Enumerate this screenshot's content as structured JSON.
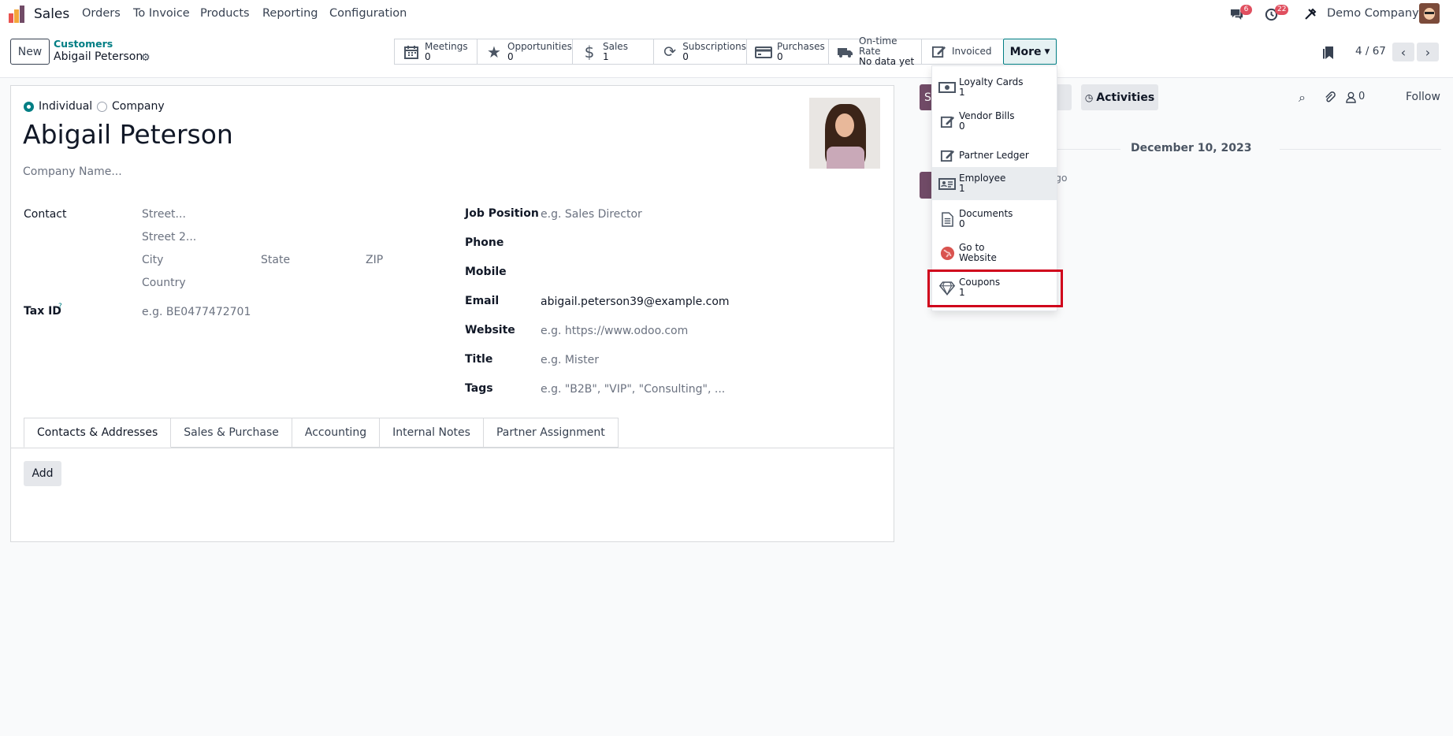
{
  "topnav": {
    "app_name": "Sales",
    "menu": [
      "Orders",
      "To Invoice",
      "Products",
      "Reporting",
      "Configuration"
    ],
    "messages_badge": "6",
    "activities_badge": "22",
    "company": "Demo Company"
  },
  "controlbar": {
    "new_label": "New",
    "breadcrumb_parent": "Customers",
    "breadcrumb_current": "Abigail Peterson",
    "smart_buttons": [
      {
        "label": "Meetings",
        "value": "0",
        "icon": "calendar-icon"
      },
      {
        "label": "Opportunities",
        "value": "0",
        "icon": "star-icon"
      },
      {
        "label": "Sales",
        "value": "1",
        "icon": "dollar-icon"
      },
      {
        "label": "Subscriptions",
        "value": "0",
        "icon": "refresh-icon"
      },
      {
        "label": "Purchases",
        "value": "0",
        "icon": "credit-card-icon"
      },
      {
        "label": "On-time Rate",
        "value": "No data yet",
        "icon": "truck-icon"
      },
      {
        "label": "Invoiced",
        "value": "",
        "icon": "edit-icon"
      }
    ],
    "more_label": "More",
    "pager": "4 / 67"
  },
  "form": {
    "type_individual": "Individual",
    "type_company": "Company",
    "name": "Abigail Peterson",
    "company_placeholder": "Company Name...",
    "contact_label": "Contact",
    "street_placeholder": "Street...",
    "street2_placeholder": "Street 2...",
    "city_placeholder": "City",
    "state_placeholder": "State",
    "zip_placeholder": "ZIP",
    "country_placeholder": "Country",
    "taxid_label": "Tax ID",
    "taxid_help": "?",
    "taxid_placeholder": "e.g. BE0477472701",
    "job_position_label": "Job Position",
    "job_position_placeholder": "e.g. Sales Director",
    "phone_label": "Phone",
    "mobile_label": "Mobile",
    "email_label": "Email",
    "email_value": "abigail.peterson39@example.com",
    "website_label": "Website",
    "website_placeholder": "e.g. https://www.odoo.com",
    "title_label": "Title",
    "title_placeholder": "e.g. Mister",
    "tags_label": "Tags",
    "tags_placeholder": "e.g. \"B2B\", \"VIP\", \"Consulting\", ...",
    "tabs": [
      "Contacts & Addresses",
      "Sales & Purchase",
      "Accounting",
      "Internal Notes",
      "Partner Assignment"
    ],
    "add_label": "Add"
  },
  "chatter": {
    "send_partial": "S",
    "note_partial": "te",
    "activities_label": "Activities",
    "followers_count": "0",
    "follow_label": "Follow",
    "date_separator": "December 10, 2023",
    "ago_partial": "go"
  },
  "more_menu": [
    {
      "label": "Loyalty Cards",
      "value": "1",
      "icon": "money-icon"
    },
    {
      "label": "Vendor Bills",
      "value": "0",
      "icon": "edit-icon"
    },
    {
      "label": "Partner Ledger",
      "value": "",
      "icon": "edit-icon"
    },
    {
      "label": "Employee",
      "value": "1",
      "icon": "id-card-icon"
    },
    {
      "label": "Documents",
      "value": "0",
      "icon": "document-icon"
    },
    {
      "label": "Go to",
      "value": "Website",
      "icon": "globe-icon"
    },
    {
      "label": "Coupons",
      "value": "1",
      "icon": "diamond-icon"
    }
  ],
  "colors": {
    "accent": "#017e84",
    "brand_purple": "#714b67",
    "highlight": "#d0021b"
  }
}
